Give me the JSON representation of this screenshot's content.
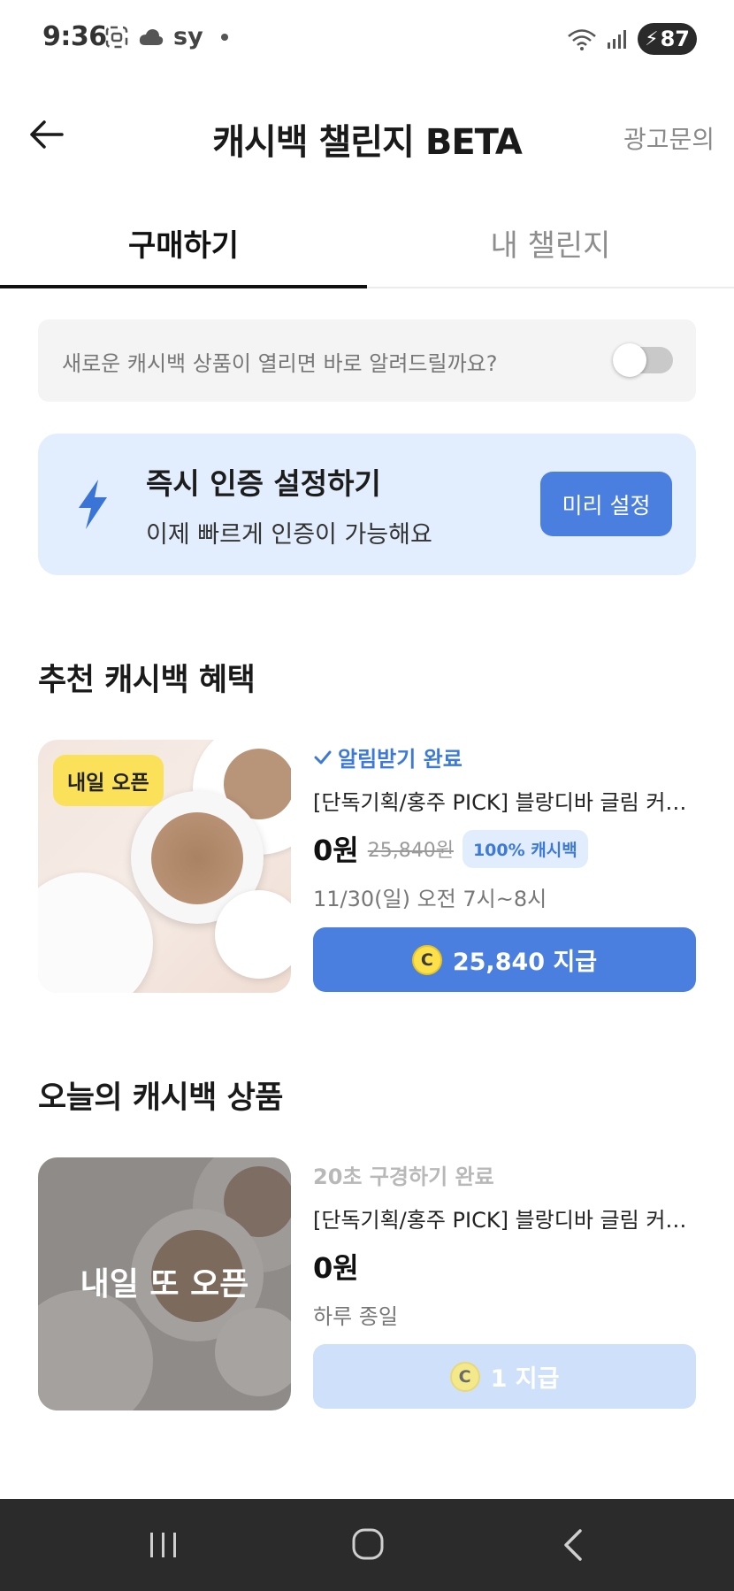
{
  "status_bar": {
    "time": "9:36",
    "left_text": "sy",
    "battery": "87",
    "icons": [
      "screenshot-icon",
      "cloud-icon",
      "dot-icon",
      "wifi-icon",
      "signal-icon",
      "battery-icon"
    ]
  },
  "header": {
    "title": "캐시백 챌린지 BETA",
    "ad_link": "광고문의"
  },
  "tabs": [
    {
      "label": "구매하기",
      "active": true
    },
    {
      "label": "내 챌린지",
      "active": false
    }
  ],
  "notify": {
    "text": "새로운 캐시백 상품이 열리면 바로 알려드릴까요?",
    "toggle_on": false
  },
  "auth": {
    "title": "즉시 인증 설정하기",
    "subtitle": "이제 빠르게 인증이 가능해요",
    "button": "미리 설정",
    "icon": "lightning-icon",
    "icon_color": "#3a74d6"
  },
  "recommended": {
    "section_title": "추천 캐시백 혜택",
    "product": {
      "badge": "내일 오픈",
      "status": "알림받기 완료",
      "name": "[단독기획/홍주 PICK] 블랑디바 글림 커…",
      "price": "0원",
      "original_price": "25,840원",
      "cashback_badge": "100% 캐시백",
      "time": "11/30(일) 오전 7시~8시",
      "coin_symbol": "C",
      "pay_label": "25,840 지급"
    }
  },
  "today": {
    "section_title": "오늘의 캐시백 상품",
    "product": {
      "overlay": "내일 또 오픈",
      "status": "20초 구경하기 완료",
      "name": "[단독기획/홍주 PICK] 블랑디바 글림 커…",
      "price": "0원",
      "time": "하루 종일",
      "coin_symbol": "C",
      "pay_label": "1 지급"
    }
  },
  "colors": {
    "accent": "#4a7fe0",
    "accent_light": "#e2eefd",
    "badge_yellow": "#fbe15a"
  }
}
